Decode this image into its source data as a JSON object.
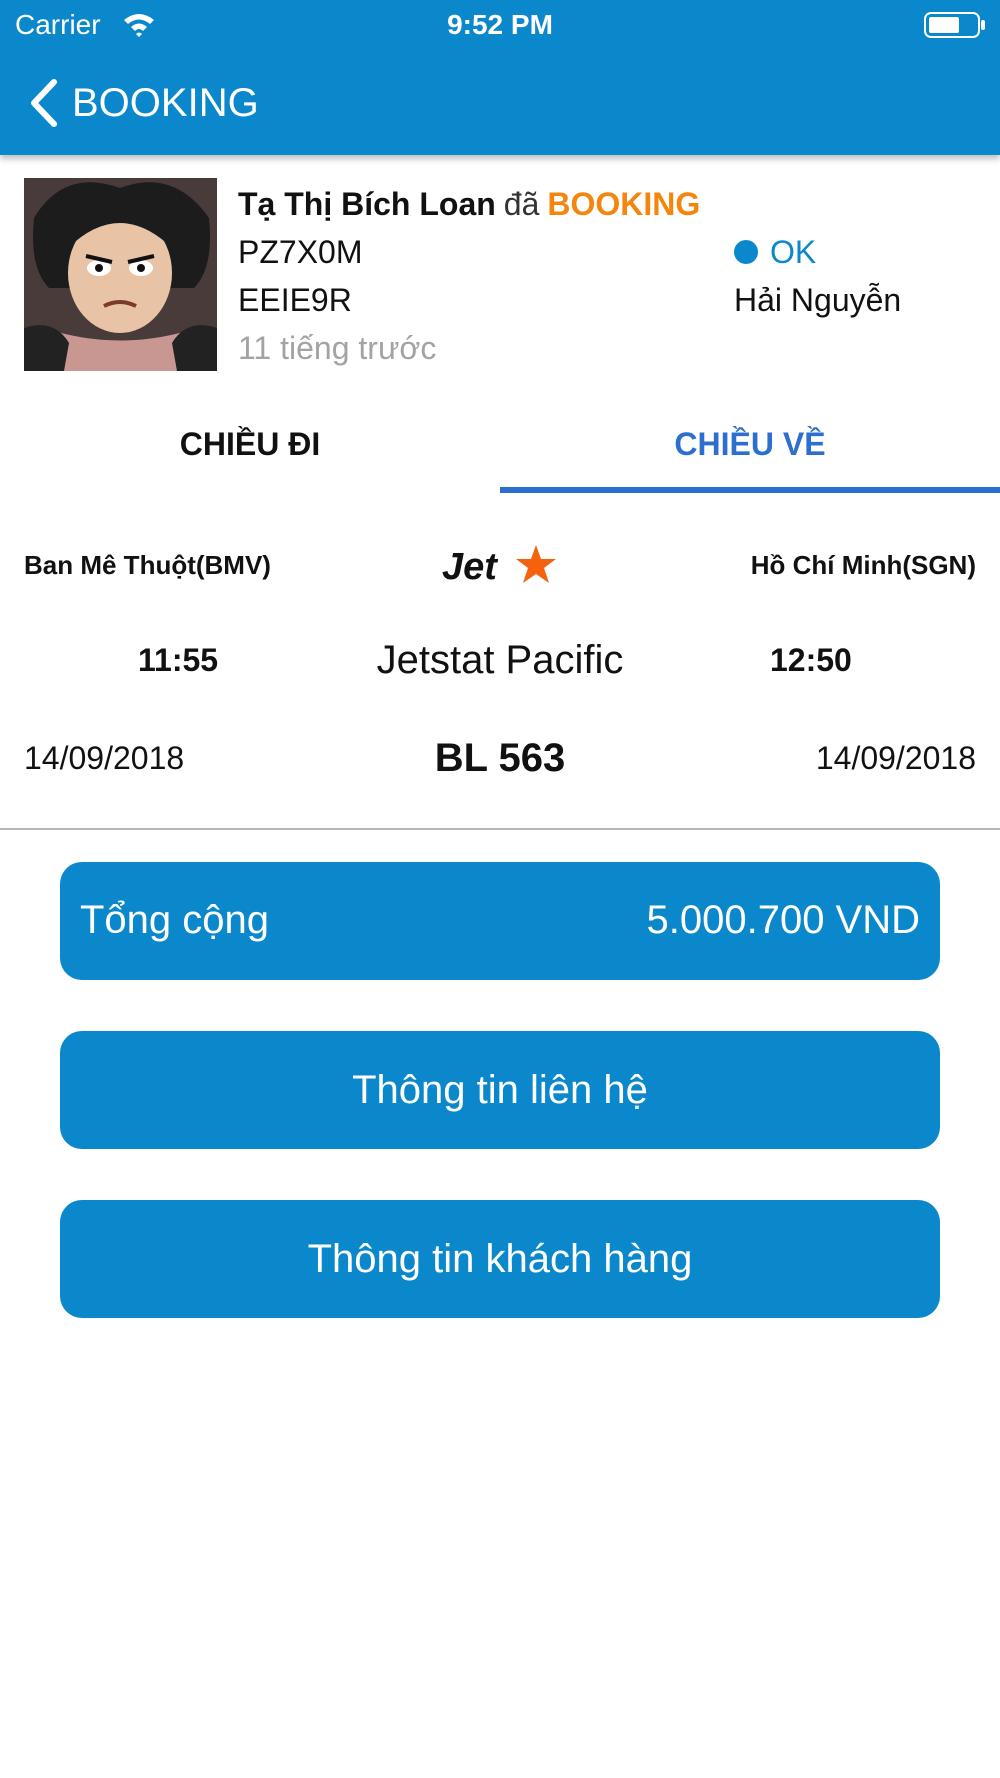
{
  "status_bar": {
    "carrier": "Carrier",
    "time": "9:52 PM",
    "icons": [
      "wifi-icon",
      "battery-icon"
    ]
  },
  "nav": {
    "back_icon": "chevron-left-icon",
    "title": "BOOKING"
  },
  "booking": {
    "user_name": "Tạ Thị Bích Loan",
    "verb": "đã",
    "action": "BOOKING",
    "code_1": "PZ7X0M",
    "code_2": "EEIE9R",
    "time_ago": "11 tiếng trước",
    "status": "OK",
    "agent": "Hải Nguyễn"
  },
  "tabs": [
    {
      "label": "CHIỀU ĐI",
      "active": false
    },
    {
      "label": "CHIỀU VỀ",
      "active": true
    }
  ],
  "flight": {
    "from": "Ban Mê Thuột(BMV)",
    "to": "Hồ Chí Minh(SGN)",
    "logo_text": "Jet",
    "departure_time": "11:55",
    "arrival_time": "12:50",
    "airline": "Jetstat Pacific",
    "departure_date": "14/09/2018",
    "arrival_date": "14/09/2018",
    "flight_number": "BL 563"
  },
  "total": {
    "label": "Tổng cộng",
    "amount": "5.000.700 VND"
  },
  "buttons": {
    "contact": "Thông tin liên hệ",
    "customer": "Thông tin khách hàng"
  },
  "colors": {
    "primary": "#0b88cb",
    "accent_orange": "#f4860d",
    "tab_active": "#2c6fcf",
    "muted": "#a3a3a3"
  }
}
